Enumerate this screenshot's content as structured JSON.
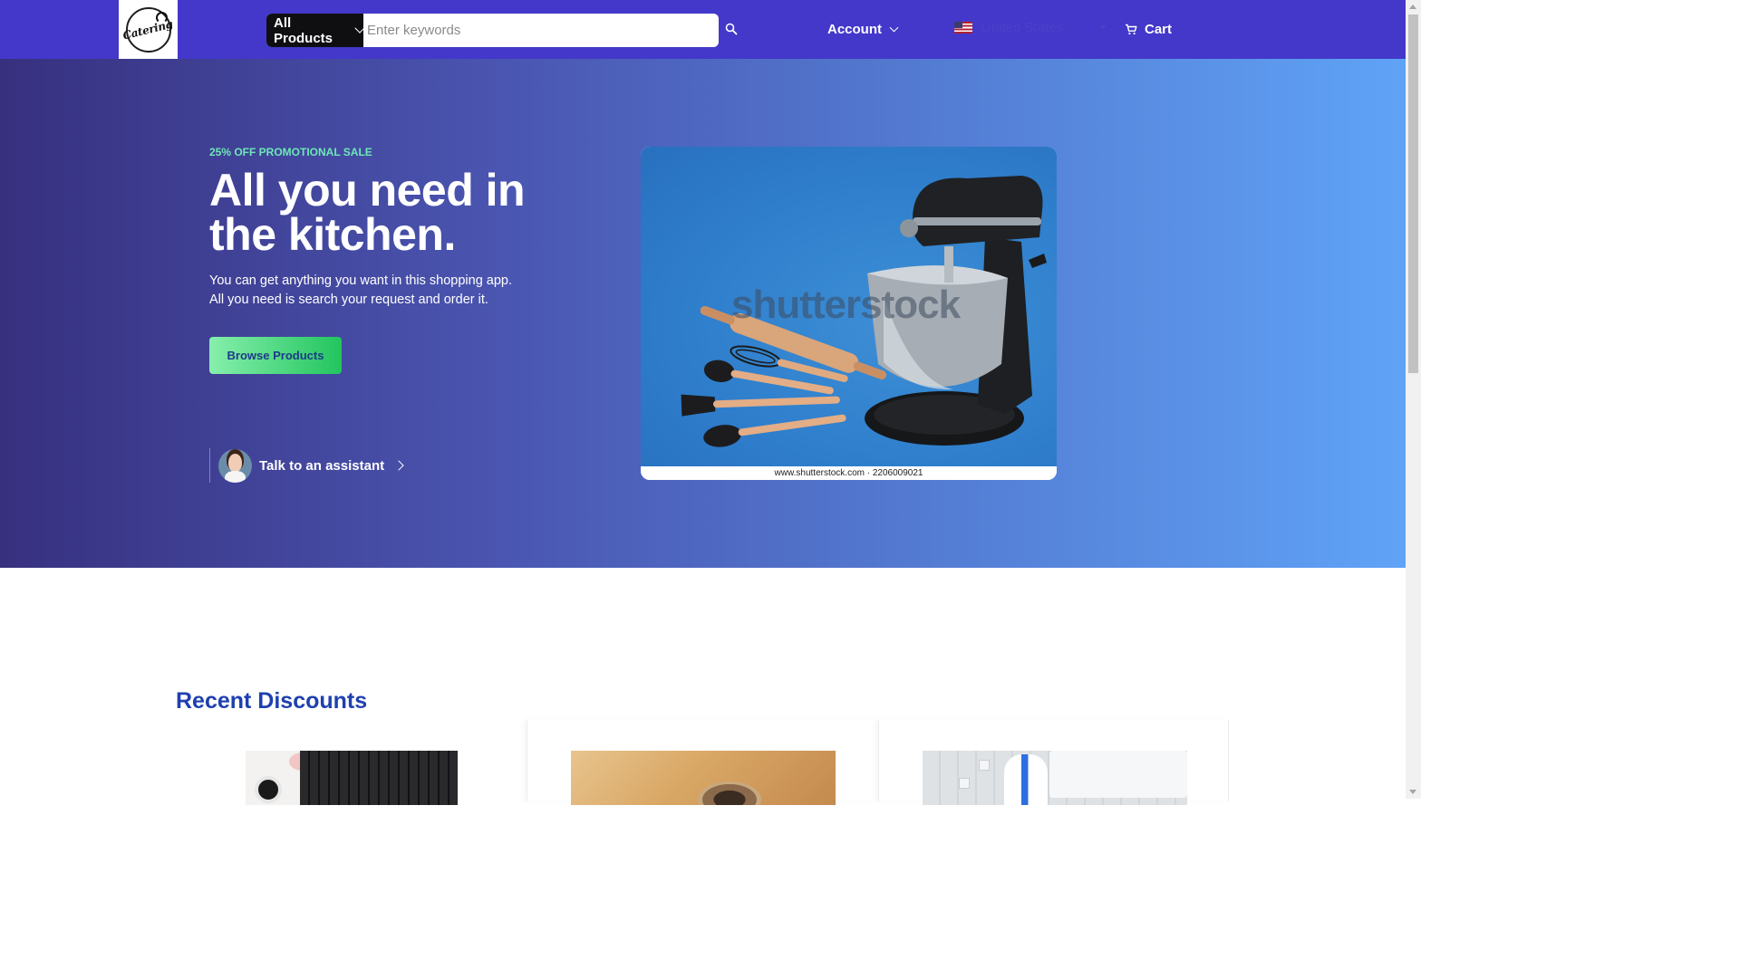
{
  "header": {
    "logo_text": "Catering",
    "search": {
      "category": "All Products",
      "placeholder": "Enter keywords",
      "value": ""
    },
    "account_label": "Account",
    "country": {
      "name": "United States",
      "flag": "us-flag-icon"
    },
    "cart_label": "Cart",
    "colors": {
      "header_bg": "#4338ca",
      "search_category_bg": "#0f0f12"
    }
  },
  "hero": {
    "promo": "25% OFF PROMOTIONAL SALE",
    "headline": "All you need in the kitchen.",
    "subtext_line1": "You can get anything you want in this shopping app.",
    "subtext_line2": "All you need is search your request and order it.",
    "browse_button": "Browse Products",
    "assistant_label": "Talk to an assistant",
    "image": {
      "watermark": "shutterstock",
      "caption": "www.shutterstock.com · 2206009021"
    },
    "colors": {
      "gradient_start": "#37307f",
      "gradient_end": "#5fa3f7",
      "promo": "#6ee7b7",
      "button": "#22c55e"
    }
  },
  "discounts": {
    "title": "Recent Discounts",
    "title_color": "#1e40af"
  }
}
